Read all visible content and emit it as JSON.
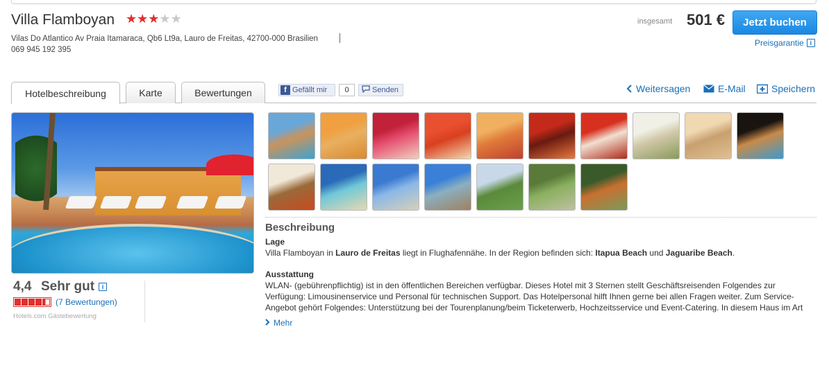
{
  "hotel": {
    "name": "Villa Flamboyan",
    "stars": 3,
    "max_stars": 5,
    "address": "Vilas Do Atlantico Av Praia Itamaraca, Qb6 Lt9a, Lauro de Freitas, 42700-000 Brasilien",
    "phone": "069 945 192 395"
  },
  "booking": {
    "price_label": "insgesamt",
    "price": "501 €",
    "book_label": "Jetzt buchen",
    "guarantee_label": "Preisgarantie"
  },
  "tabs": [
    {
      "label": "Hotelbeschreibung",
      "active": true
    },
    {
      "label": "Karte",
      "active": false
    },
    {
      "label": "Bewertungen",
      "active": false
    }
  ],
  "social": {
    "like_label": "Gefällt mir",
    "like_count": "0",
    "send_label": "Senden"
  },
  "share": {
    "weitersagen": "Weitersagen",
    "email": "E-Mail",
    "save": "Speichern"
  },
  "rating": {
    "score": "4,4",
    "label": "Sehr gut",
    "level": 4.4,
    "max": 5,
    "reviews_link": "(7 Bewertungen)",
    "source": "Hotels.com Gästebewertung"
  },
  "gallery": {
    "thumbnails": [
      {
        "colors": [
          "#6aa7d9",
          "#c9935c",
          "#3aa3d6"
        ]
      },
      {
        "colors": [
          "#f0a040",
          "#e8b060",
          "#d98a30"
        ]
      },
      {
        "colors": [
          "#c2213a",
          "#e65070",
          "#f0d0c0"
        ]
      },
      {
        "colors": [
          "#e85030",
          "#d84020",
          "#f3d9b0"
        ]
      },
      {
        "colors": [
          "#f0b060",
          "#e07a3a",
          "#c04030"
        ]
      },
      {
        "colors": [
          "#c42a1a",
          "#6a1a10",
          "#e87a40"
        ]
      },
      {
        "colors": [
          "#d83020",
          "#f0e0d0",
          "#b02818"
        ]
      },
      {
        "colors": [
          "#f0f0e6",
          "#d0c8a8",
          "#8a9a5a"
        ]
      },
      {
        "colors": [
          "#f0d8b0",
          "#c8a070",
          "#e0c090"
        ]
      },
      {
        "colors": [
          "#1a1410",
          "#c88a4a",
          "#3a9ad0"
        ]
      },
      {
        "colors": [
          "#f0e8d8",
          "#9a6a3a",
          "#c84a20"
        ]
      },
      {
        "colors": [
          "#2a6ab8",
          "#70c8d8",
          "#e8d8b0"
        ]
      },
      {
        "colors": [
          "#3a7ad0",
          "#8ab8e8",
          "#d8d0b8"
        ]
      },
      {
        "colors": [
          "#3a80d8",
          "#8ab0c0",
          "#a08060"
        ]
      },
      {
        "colors": [
          "#c8d8e8",
          "#5a8a3a",
          "#6aa04a"
        ]
      },
      {
        "colors": [
          "#5a7a3a",
          "#8ab060",
          "#c0c0a0"
        ]
      },
      {
        "colors": [
          "#3a5a2a",
          "#c87030",
          "#7a9a5a"
        ]
      }
    ]
  },
  "description": {
    "heading": "Beschreibung",
    "lage_heading": "Lage",
    "lage_prefix": "Villa Flamboyan in ",
    "lage_city": "Lauro de Freitas",
    "lage_middle": " liegt in Flughafennähe. In der Region befinden sich: ",
    "lage_poi1": "Itapua Beach",
    "lage_and": " und ",
    "lage_poi2": "Jaguaribe Beach",
    "lage_end": ".",
    "ausstattung_heading": "Ausstattung",
    "ausstattung_text": "WLAN- (gebührenpflichtig) ist in den öffentlichen Bereichen verfügbar. Dieses Hotel mit 3 Sternen stellt Geschäftsreisenden Folgendes zur Verfügung: Limousinenservice und Personal für technischen Support. Das Hotelpersonal hilft Ihnen gerne bei allen Fragen weiter. Zum Service-Angebot gehört Folgendes: Unterstützung bei der Tourenplanung/beim Ticketerwerb, Hochzeitsservice und Event-Catering. In diesem Haus im Art",
    "more_label": "Mehr"
  }
}
